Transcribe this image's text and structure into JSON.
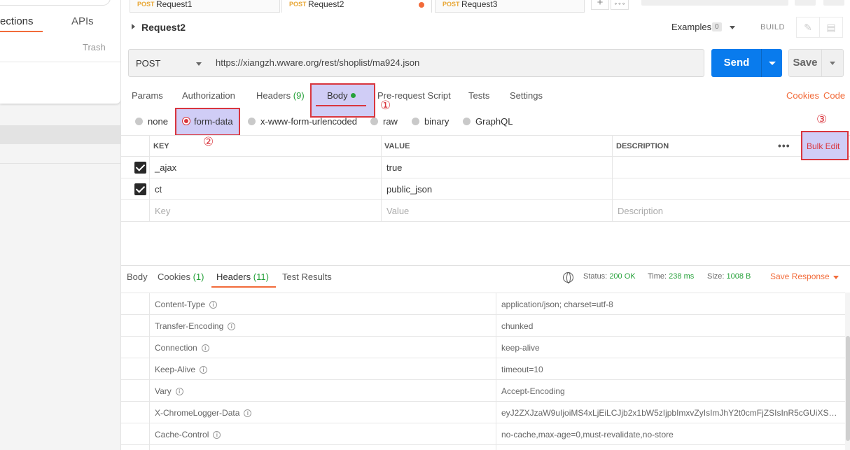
{
  "sidebar": {
    "tabs": [
      "ections",
      "APIs"
    ],
    "trash_label": "Trash"
  },
  "request_tabs": [
    {
      "method": "POST",
      "name": "Request1",
      "unsaved": false
    },
    {
      "method": "POST",
      "name": "Request2",
      "unsaved": true
    },
    {
      "method": "POST",
      "name": "Request3",
      "unsaved": false
    }
  ],
  "tab_controls": {
    "add": "+",
    "more": "∘∘∘"
  },
  "request": {
    "title": "Request2",
    "examples_label": "Examples",
    "examples_count": "0",
    "build_label": "BUILD",
    "method": "POST",
    "url": "https://xiangzh.wware.org/rest/shoplist/ma924.json",
    "send_label": "Send",
    "save_label": "Save"
  },
  "request_subtabs": {
    "params": "Params",
    "authorization": "Authorization",
    "headers": "Headers",
    "headers_count": "(9)",
    "body": "Body",
    "prerequest": "Pre-request Script",
    "tests": "Tests",
    "settings": "Settings",
    "cookies": "Cookies",
    "code": "Code"
  },
  "annotations": {
    "one": "①",
    "two": "②",
    "three": "③"
  },
  "body_types": {
    "none": "none",
    "form_data": "form-data",
    "urlencoded": "x-www-form-urlencoded",
    "raw": "raw",
    "binary": "binary",
    "graphql": "GraphQL"
  },
  "params_table": {
    "headers": {
      "key": "KEY",
      "value": "VALUE",
      "description": "DESCRIPTION"
    },
    "more": "•••",
    "bulk_edit": "Bulk Edit",
    "rows": [
      {
        "key": "_ajax",
        "value": "true"
      },
      {
        "key": "ct",
        "value": "public_json"
      }
    ],
    "placeholder": {
      "key": "Key",
      "value": "Value",
      "description": "Description"
    }
  },
  "response": {
    "tabs": {
      "body": "Body",
      "cookies": "Cookies",
      "cookies_count": "(1)",
      "headers": "Headers",
      "headers_count": "(11)",
      "test_results": "Test Results"
    },
    "status_label": "Status:",
    "status_value": "200 OK",
    "time_label": "Time:",
    "time_value": "238 ms",
    "size_label": "Size:",
    "size_value": "1008 B",
    "save_response": "Save Response",
    "headers": [
      {
        "key": "Content-Type",
        "value": "application/json; charset=utf-8"
      },
      {
        "key": "Transfer-Encoding",
        "value": "chunked"
      },
      {
        "key": "Connection",
        "value": "keep-alive"
      },
      {
        "key": "Keep-Alive",
        "value": "timeout=10"
      },
      {
        "key": "Vary",
        "value": "Accept-Encoding"
      },
      {
        "key": "X-ChromeLogger-Data",
        "value": "eyJ2ZXJzaW9uIjoiMS4xLjEiLCJjb2x1bW5zIjpbImxvZyIsImJhY2t0cmFjZSIsInR5cGUiXSwic..."
      },
      {
        "key": "Cache-Control",
        "value": "no-cache,max-age=0,must-revalidate,no-store"
      }
    ]
  },
  "colors": {
    "accent_orange": "#f26b3a",
    "send_blue": "#097bed",
    "status_green": "#26a13a",
    "highlight_fill": "#d0cdf6",
    "highlight_border": "#d9363e"
  }
}
